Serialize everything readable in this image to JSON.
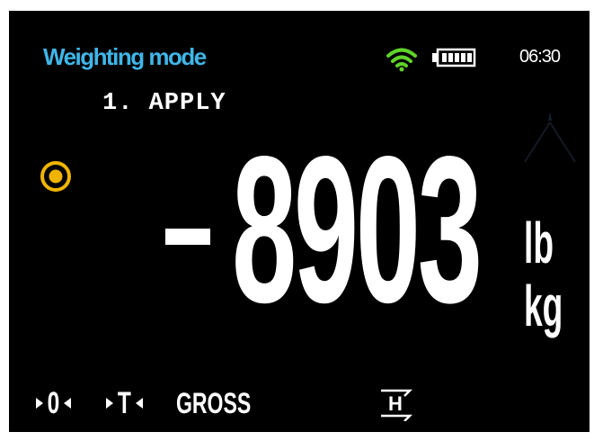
{
  "header": {
    "mode_title": "Weighting mode",
    "wifi_icon": "wifi-icon",
    "battery_icon": "battery-icon",
    "time": "06:30"
  },
  "prompt": {
    "text": "1. APPLY"
  },
  "indicator": {
    "icon": "target-icon",
    "color": "#f0b400"
  },
  "reading": {
    "sign": "-",
    "value": "8903",
    "units": [
      "lb",
      "kg"
    ]
  },
  "status_bar": {
    "zero_label": "0",
    "tare_label": "T",
    "gross_label": "GROSS",
    "hold_label": "H"
  },
  "colors": {
    "background": "#000000",
    "accent": "#3fb6e8",
    "wifi": "#5fd32a",
    "text": "#ffffff"
  }
}
